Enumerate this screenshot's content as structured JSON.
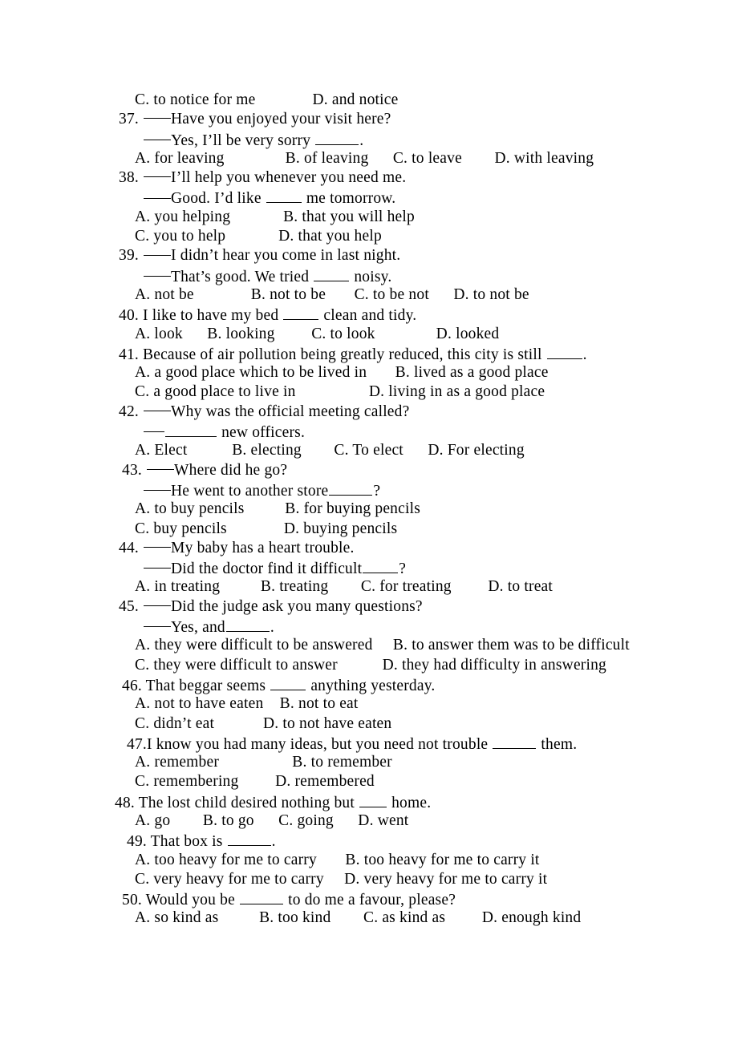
{
  "document": {
    "type": "english-grammar-multiple-choice-worksheet",
    "page_background": "#ffffff",
    "text_color": "#000000"
  },
  "lines": [
    {
      "id": "l01",
      "indent": "opt",
      "text": "C. to notice for me              D. and notice"
    },
    {
      "id": "l02",
      "indent": "b",
      "text": "37. ",
      "dash": "long",
      "after": "Have you enjoyed your visit here?"
    },
    {
      "id": "l03",
      "indent": "reply",
      "text": "",
      "dash": "long",
      "after": "Yes, I’ll be very sorry ",
      "blank": "lg",
      "tail": "."
    },
    {
      "id": "l04",
      "indent": "opt",
      "text": "A. for leaving               B. of leaving      C. to leave        D. with leaving"
    },
    {
      "id": "l05",
      "indent": "b",
      "text": "38. ",
      "dash": "long",
      "after": "I’ll help you whenever you need me."
    },
    {
      "id": "l06",
      "indent": "reply",
      "text": "",
      "dash": "long",
      "after": "Good. I’d like ",
      "blank": "md",
      "tail": " me tomorrow."
    },
    {
      "id": "l07",
      "indent": "opt",
      "text": "A. you helping             B. that you will help"
    },
    {
      "id": "l08",
      "indent": "opt",
      "text": "C. you to help             D. that you help"
    },
    {
      "id": "l09",
      "indent": "b",
      "text": "39. ",
      "dash": "long",
      "after": "I didn’t hear you come in last night."
    },
    {
      "id": "l10",
      "indent": "reply",
      "text": "",
      "dash": "long",
      "after": "That’s good. We tried ",
      "blank": "md",
      "tail": " noisy."
    },
    {
      "id": "l11",
      "indent": "opt",
      "text": "A. not be              B. not to be       C. to be not      D. to not be"
    },
    {
      "id": "l12",
      "indent": "b",
      "text": "40. I like to have my bed ",
      "blank": "md",
      "tail": " clean and tidy."
    },
    {
      "id": "l13",
      "indent": "opt",
      "text": "A. look      B. looking         C. to look               D. looked"
    },
    {
      "id": "l14",
      "indent": "b",
      "text": "41. Because of air pollution being greatly reduced, this city is still ",
      "blank": "md",
      "tail": "."
    },
    {
      "id": "l15",
      "indent": "opt",
      "text": "A. a good place which to be lived in       B. lived as a good place"
    },
    {
      "id": "l16",
      "indent": "opt",
      "text": "C. a good place to live in                  D. living in as a good place"
    },
    {
      "id": "l17",
      "indent": "b",
      "text": "42. ",
      "dash": "long",
      "after": "Why was the official meeting called?"
    },
    {
      "id": "l18",
      "indent": "reply",
      "text": "",
      "dash": "short",
      "blank": "xl",
      "tail": " new officers."
    },
    {
      "id": "l19",
      "indent": "opt",
      "text": "A. Elect           B. electing        C. To elect      D. For electing"
    },
    {
      "id": "l20",
      "indent": "c",
      "text": "43. ",
      "dash": "long",
      "after": "Where did he go?"
    },
    {
      "id": "l21",
      "indent": "reply",
      "text": "",
      "dash": "long",
      "after": "He went to another store",
      "blank": "lg",
      "tail": "?"
    },
    {
      "id": "l22",
      "indent": "opt",
      "text": "A. to buy pencils          B. for buying pencils"
    },
    {
      "id": "l23",
      "indent": "opt",
      "text": "C. buy pencils              D. buying pencils"
    },
    {
      "id": "l24",
      "indent": "b",
      "text": "44. ",
      "dash": "long",
      "after": "My baby has a heart trouble."
    },
    {
      "id": "l25",
      "indent": "reply",
      "text": "",
      "dash": "long",
      "after": "Did the doctor find it difficult",
      "blank": "md",
      "tail": "?"
    },
    {
      "id": "l26",
      "indent": "opt",
      "text": "A. in treating          B. treating        C. for treating         D. to treat"
    },
    {
      "id": "l27",
      "indent": "b",
      "text": "45. ",
      "dash": "long",
      "after": "Did the judge ask you many questions?"
    },
    {
      "id": "l28",
      "indent": "reply",
      "text": "",
      "dash": "long",
      "after": "Yes, and",
      "blank": "lg",
      "tail": "."
    },
    {
      "id": "l29",
      "indent": "opt",
      "text": "A. they were difficult to be answered     B. to answer them was to be difficult"
    },
    {
      "id": "l30",
      "indent": "opt",
      "text": "C. they were difficult to answer           D. they had difficulty in answering"
    },
    {
      "id": "l31",
      "indent": "c",
      "text": "46. That beggar seems ",
      "blank": "md",
      "tail": " anything yesterday."
    },
    {
      "id": "l32",
      "indent": "opt",
      "text": "A. not to have eaten    B. not to eat"
    },
    {
      "id": "l33",
      "indent": "opt",
      "text": "C. didn’t eat            D. to not have eaten"
    },
    {
      "id": "l34",
      "indent": "d",
      "text": "47.I know you had many ideas, but you need not trouble ",
      "blank": "lg",
      "tail": " them."
    },
    {
      "id": "l35",
      "indent": "opt",
      "text": "A. remember                  B. to remember"
    },
    {
      "id": "l36",
      "indent": "opt",
      "text": "C. remembering         D. remembered"
    },
    {
      "id": "l37",
      "indent": "a",
      "text": "48. The lost child desired nothing but ",
      "blank": "sm",
      "tail": " home."
    },
    {
      "id": "l38",
      "indent": "opt",
      "text": "A. go        B. to go      C. going      D. went"
    },
    {
      "id": "l39",
      "indent": "d",
      "text": "49. That box is ",
      "blank": "lg",
      "tail": "."
    },
    {
      "id": "l40",
      "indent": "opt",
      "text": "A. too heavy for me to carry       B. too heavy for me to carry it"
    },
    {
      "id": "l41",
      "indent": "opt",
      "text": "C. very heavy for me to carry     D. very heavy for me to carry it"
    },
    {
      "id": "l42",
      "indent": "c",
      "text": "50. Would you be ",
      "blank": "lg",
      "tail": " to do me a favour, please?"
    },
    {
      "id": "l43",
      "indent": "opt",
      "text": "A. so kind as          B. too kind        C. as kind as         D. enough kind"
    }
  ]
}
